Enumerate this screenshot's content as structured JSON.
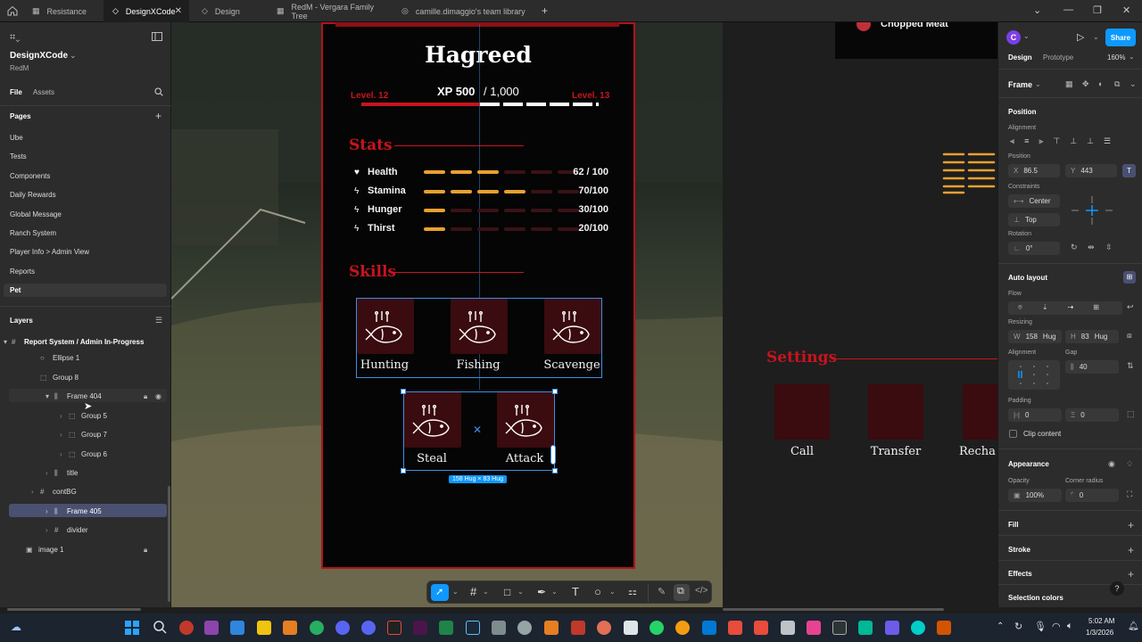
{
  "tabs": [
    {
      "label": "Resistance"
    },
    {
      "label": "DesignXCode"
    },
    {
      "label": "Design"
    },
    {
      "label": "RedM - Vergara Family Tree"
    },
    {
      "label": "camille.dimaggio's team library"
    }
  ],
  "file": {
    "name": "DesignXCode",
    "project": "RedM",
    "tab_file": "File",
    "tab_assets": "Assets"
  },
  "pages": {
    "header": "Pages",
    "items": [
      "Ube",
      "Tests",
      "Components",
      "Daily Rewards",
      "Global Message",
      "Ranch System",
      "Player Info > Admin View",
      "Reports",
      "Pet"
    ]
  },
  "layers": {
    "header": "Layers",
    "items": [
      "Report System / Admin In-Progress",
      "Ellipse 1",
      "Group 8",
      "Frame 404",
      "Group 5",
      "Group 7",
      "Group 6",
      "title",
      "contBG",
      "Frame 405",
      "divider",
      "image 1"
    ]
  },
  "game": {
    "player_name": "Hagreed",
    "level_current": "Level. 12",
    "level_next": "Level. 13",
    "xp_label": "XP 500",
    "xp_total": "/ 1,000",
    "xp_progress": 0.5,
    "stats_title": "Stats",
    "stats": [
      {
        "name": "Health",
        "value": "62 / 100",
        "fill": 0.62
      },
      {
        "name": "Stamina",
        "value": "70/100",
        "fill": 0.7
      },
      {
        "name": "Hunger",
        "value": "30/100",
        "fill": 0.3
      },
      {
        "name": "Thirst",
        "value": "20/100",
        "fill": 0.2
      }
    ],
    "skills_title": "Skills",
    "skills_row1": [
      "Hunting",
      "Fishing",
      "Scavenge"
    ],
    "skills_row2": [
      "Steal",
      "Attack"
    ],
    "selection_badge": "158 Hug × 83 Hug",
    "settings_title": "Settings",
    "settings_items": [
      "Call",
      "Transfer",
      "Recha"
    ],
    "notification": "Chopped Meat"
  },
  "design_panel": {
    "avatar": "C",
    "share": "Share",
    "tab_design": "Design",
    "tab_prototype": "Prototype",
    "zoom": "160%",
    "frame_label": "Frame",
    "position": "Position",
    "alignment": "Alignment",
    "position_sub": "Position",
    "x_label": "X",
    "x": "86.5",
    "y_label": "Y",
    "y": "443",
    "constraints": "Constraints",
    "constraint_h": "Center",
    "constraint_v": "Top",
    "rotation": "Rotation",
    "rotation_val": "0°",
    "auto_layout": "Auto layout",
    "flow": "Flow",
    "resizing": "Resizing",
    "w_label": "W",
    "w": "158",
    "w_mode": "Hug",
    "h_label": "H",
    "h": "83",
    "h_mode": "Hug",
    "alignment2": "Alignment",
    "gap": "Gap",
    "gap_val": "40",
    "padding": "Padding",
    "pad_h": "0",
    "pad_v": "0",
    "clip": "Clip content",
    "appearance": "Appearance",
    "opacity": "Opacity",
    "opacity_val": "100%",
    "radius": "Corner radius",
    "radius_val": "0",
    "fill": "Fill",
    "stroke": "Stroke",
    "effects": "Effects",
    "selection_colors": "Selection colors"
  },
  "taskbar": {
    "time": "5:02 AM",
    "date": "1/3/2026"
  },
  "colors": {
    "accent": "#0d99ff",
    "brand_red": "#c8141e",
    "stat_orange": "#e8a030",
    "bg": "#1e1e1e",
    "panel": "#2c2c2c"
  }
}
